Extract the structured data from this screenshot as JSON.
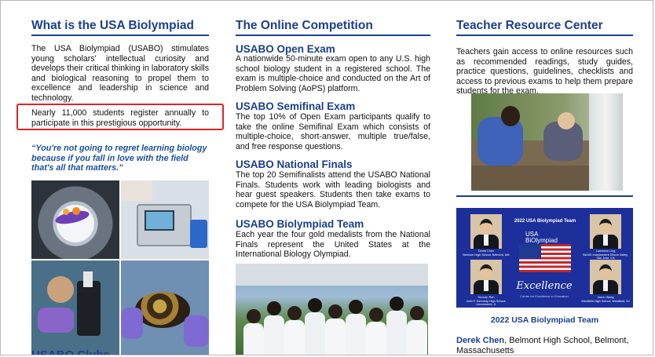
{
  "col1": {
    "heading": "What is the USA Biolympiad",
    "intro": "The USA Biolympiad (USABO) stimulates young scholars' intellectual curiosity and develops their critical thinking in laboratory skills and biological reasoning to propel them to excellence and leadership in science and technology.",
    "highlight": "Nearly 11,000 students register annually to participate in this prestigious opportunity.",
    "quote": "“You're not going to regret learning biology because if you fall in love with the field that's all that matters.”",
    "clubs_heading": "USABO Clubs"
  },
  "col2": {
    "heading": "The Online Competition",
    "sections": [
      {
        "title": "USABO Open Exam",
        "body": "A nationwide 50-minute exam open to any U.S. high school biology student in a registered school. The exam is multiple-choice and conducted on the Art of Problem Solving (AoPS) platform."
      },
      {
        "title": "USABO Semifinal Exam",
        "body": "The top 10% of Open Exam participants qualify to take the online Semifinal Exam which consists of multiple-choice, short-answer, multiple true/false, and free response questions."
      },
      {
        "title": "USABO National Finals",
        "body": "The top 20 Semifinalists attend the USABO National Finals. Students work with leading biologists and hear guest speakers. Students then take exams to compete for the USA Biolympiad Team."
      },
      {
        "title": "USABO Biolympiad Team",
        "body": "Each year the four gold medalists from the National Finals represent the United States at the International Biology Olympiad."
      }
    ]
  },
  "col3": {
    "heading": "Teacher Resource Center",
    "intro": "Teachers gain access to online resources such as recommended readings, study guides, practice questions, guidelines, checklists and access to previous exams to help them prepare students for the exam.",
    "card": {
      "title": "2022 USA Biolympiad Team",
      "logo_line1": "USA",
      "logo_line2": "BiOlympiad",
      "excellence": "Excellence",
      "tagline": "Center for Excellence in Education",
      "members": [
        {
          "name": "Derek Chen",
          "school": "Belmont High School, Belmont, MA"
        },
        {
          "name": "Lawrence Ling",
          "school": "BASIS Independent Silicon Valley, San Jose, CA"
        },
        {
          "name": "Duncan Ren",
          "school": "John F. Kennedy High School, Lincolnshire, IL"
        },
        {
          "name": "Jason Wang",
          "school": "Westfield High School, Westfield, NJ"
        }
      ]
    },
    "caption": "2022 USA Biolympiad Team",
    "person_name": "Derek Chen",
    "person_details": ", Belmont High School, Belmont, Massachusetts"
  }
}
